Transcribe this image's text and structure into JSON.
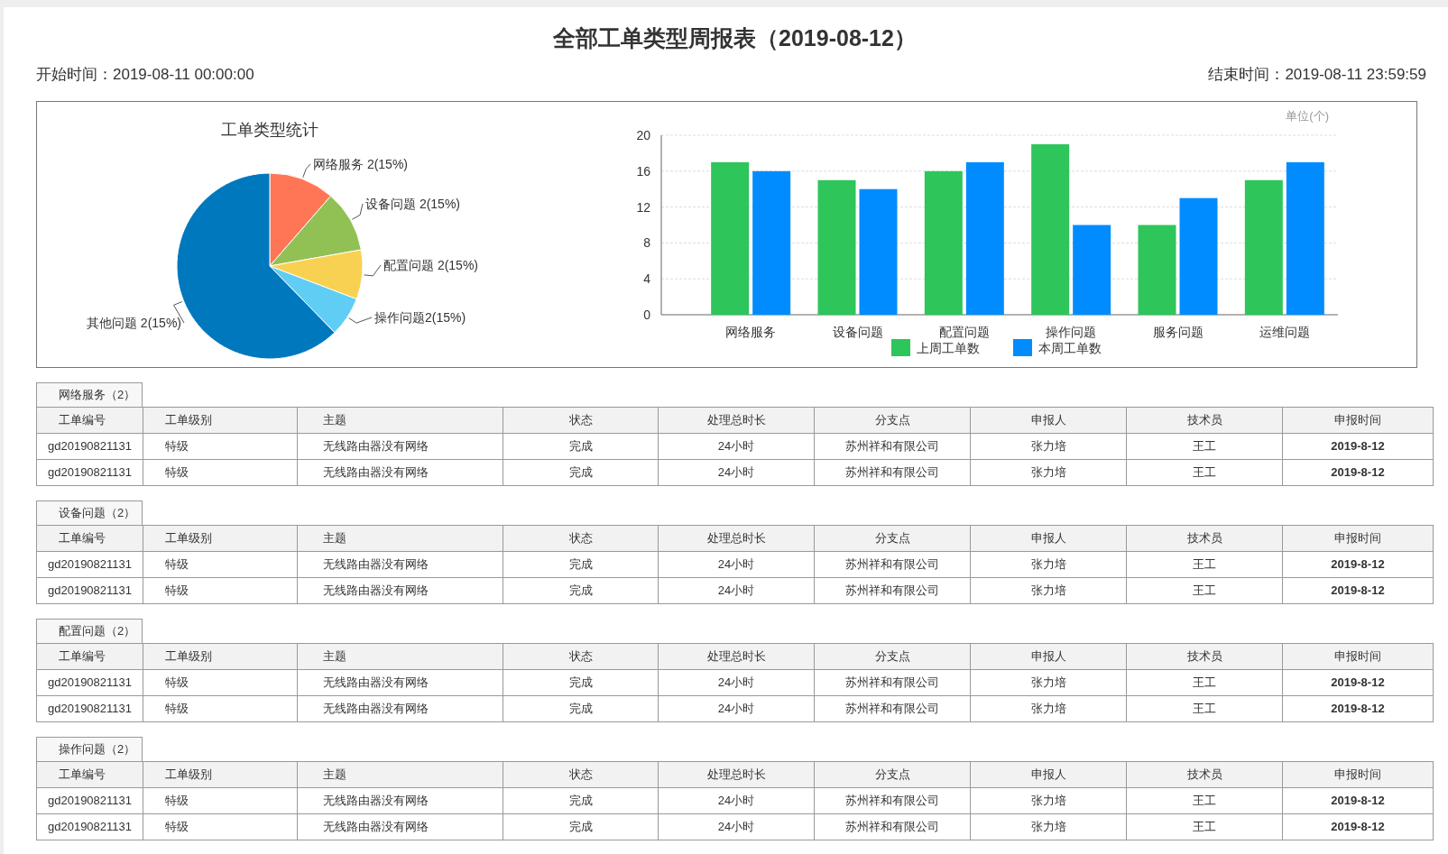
{
  "title": "全部工单类型周报表（2019-08-12）",
  "start_time": "开始时间：2019-08-11 00:00:00",
  "end_time": "结束时间：2019-08-11 23:59:59",
  "pie_chart": {
    "title": "工单类型统计",
    "slices": [
      {
        "label": "网络服务 2(15%)",
        "color": "#ff7656"
      },
      {
        "label": "设备问题 2(15%)",
        "color": "#91c154"
      },
      {
        "label": "配置问题 2(15%)",
        "color": "#f9d152"
      },
      {
        "label": "操作问题2(15%)",
        "color": "#5fcdf4"
      },
      {
        "label": "其他问题 2(15%)",
        "color": "#0078be"
      }
    ]
  },
  "bar_chart": {
    "unit": "单位(个)",
    "chart_data": {
      "type": "bar",
      "categories": [
        "网络服务",
        "设备问题",
        "配置问题",
        "操作问题",
        "服务问题",
        "运维问题"
      ],
      "series": [
        {
          "name": "上周工单数",
          "color": "#2ec55a",
          "values": [
            17,
            15,
            16,
            19,
            10,
            15
          ]
        },
        {
          "name": "本周工单数",
          "color": "#008cff",
          "values": [
            16,
            14,
            17,
            10,
            13,
            17
          ]
        }
      ],
      "ylim": [
        0,
        20
      ],
      "yticks": [
        0,
        4,
        8,
        12,
        16,
        20
      ],
      "grid": true,
      "legend": true
    }
  },
  "sections": [
    {
      "caption": "网络服务（2）",
      "columns": [
        "工单编号",
        "工单级别",
        "主题",
        "状态",
        "处理总时长",
        "分支点",
        "申报人",
        "技术员",
        "申报时间"
      ],
      "rows": [
        [
          "gd20190821131",
          "特级",
          "无线路由器没有网络",
          "完成",
          "24小时",
          "苏州祥和有限公司",
          "张力培",
          "王工",
          "2019-8-12"
        ],
        [
          "gd20190821131",
          "特级",
          "无线路由器没有网络",
          "完成",
          "24小时",
          "苏州祥和有限公司",
          "张力培",
          "王工",
          "2019-8-12"
        ]
      ]
    },
    {
      "caption": "设备问题（2）",
      "columns": [
        "工单编号",
        "工单级别",
        "主题",
        "状态",
        "处理总时长",
        "分支点",
        "申报人",
        "技术员",
        "申报时间"
      ],
      "rows": [
        [
          "gd20190821131",
          "特级",
          "无线路由器没有网络",
          "完成",
          "24小时",
          "苏州祥和有限公司",
          "张力培",
          "王工",
          "2019-8-12"
        ],
        [
          "gd20190821131",
          "特级",
          "无线路由器没有网络",
          "完成",
          "24小时",
          "苏州祥和有限公司",
          "张力培",
          "王工",
          "2019-8-12"
        ]
      ]
    },
    {
      "caption": "配置问题（2）",
      "columns": [
        "工单编号",
        "工单级别",
        "主题",
        "状态",
        "处理总时长",
        "分支点",
        "申报人",
        "技术员",
        "申报时间"
      ],
      "rows": [
        [
          "gd20190821131",
          "特级",
          "无线路由器没有网络",
          "完成",
          "24小时",
          "苏州祥和有限公司",
          "张力培",
          "王工",
          "2019-8-12"
        ],
        [
          "gd20190821131",
          "特级",
          "无线路由器没有网络",
          "完成",
          "24小时",
          "苏州祥和有限公司",
          "张力培",
          "王工",
          "2019-8-12"
        ]
      ]
    },
    {
      "caption": "操作问题（2）",
      "columns": [
        "工单编号",
        "工单级别",
        "主题",
        "状态",
        "处理总时长",
        "分支点",
        "申报人",
        "技术员",
        "申报时间"
      ],
      "rows": [
        [
          "gd20190821131",
          "特级",
          "无线路由器没有网络",
          "完成",
          "24小时",
          "苏州祥和有限公司",
          "张力培",
          "王工",
          "2019-8-12"
        ],
        [
          "gd20190821131",
          "特级",
          "无线路由器没有网络",
          "完成",
          "24小时",
          "苏州祥和有限公司",
          "张力培",
          "王工",
          "2019-8-12"
        ]
      ]
    }
  ]
}
